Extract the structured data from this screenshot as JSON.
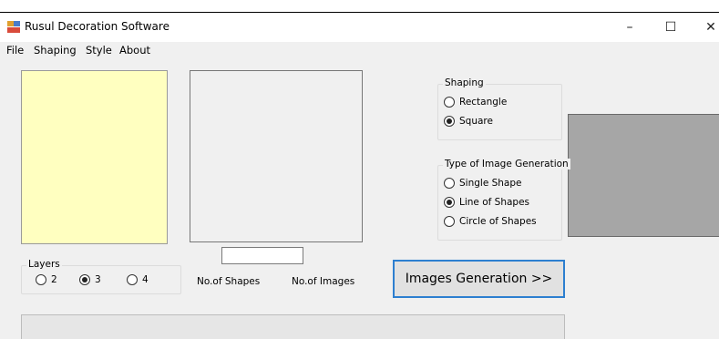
{
  "window": {
    "title": "Rusul Decoration Software",
    "controls": {
      "minimize": "–",
      "maximize": "☐",
      "close": "✕"
    }
  },
  "menu": [
    "File",
    "Shaping",
    "Style",
    "About"
  ],
  "layers": {
    "legend": "Layers",
    "options": [
      "2",
      "3",
      "4"
    ],
    "selected": "3"
  },
  "shaping": {
    "legend": "Shaping",
    "options": [
      "Rectangle",
      "Square"
    ],
    "selected": "Square"
  },
  "generation_type": {
    "legend": "Type of Image Generation",
    "options": [
      "Single Shape",
      "Line of Shapes",
      "Circle of Shapes"
    ],
    "selected": "Line of Shapes"
  },
  "shapes_input": {
    "value": ""
  },
  "labels": {
    "num_shapes": "No.of Shapes",
    "num_images": "No.of Images"
  },
  "generate_button": "Images Generation >>",
  "colors": {
    "yellow_panel": "#ffffc0",
    "gray_panel": "#a6a6a6",
    "button_border": "#2d7fd0"
  }
}
